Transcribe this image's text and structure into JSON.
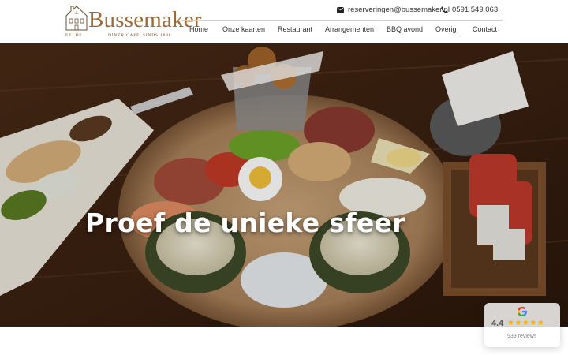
{
  "brand": {
    "name": "Bussemaker",
    "tagline_left": "EELDE",
    "tagline_mid": "DINER CAFE",
    "tagline_right": "SINDS 1888",
    "color": "#9c6a35"
  },
  "contact": {
    "email": "reserveringen@bussemaker.nl",
    "email_icon": "envelope-icon",
    "phone": "0591 549 063",
    "phone_icon": "phone-icon"
  },
  "nav": {
    "items": [
      {
        "label": "Home"
      },
      {
        "label": "Onze kaarten"
      },
      {
        "label": "Restaurant"
      },
      {
        "label": "Arrangementen"
      },
      {
        "label": "BBQ avond"
      },
      {
        "label": "Overig"
      },
      {
        "label": "Contact"
      }
    ]
  },
  "hero": {
    "title": "Proef de unieke sfeer"
  },
  "review_widget": {
    "icon": "google-icon",
    "score": "4.4",
    "stars": "★★★★★",
    "count": "939 reviews"
  }
}
